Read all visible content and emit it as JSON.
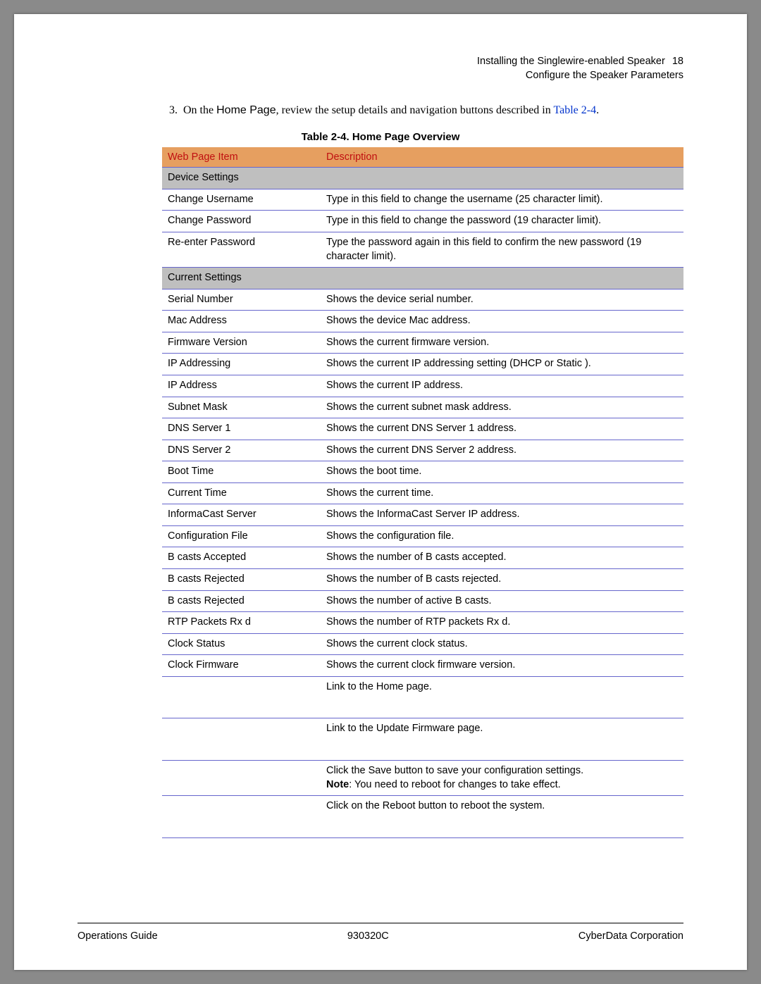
{
  "header": {
    "line1": "Installing the Singlewire-enabled Speaker",
    "page_number": "18",
    "line2": "Configure the Speaker Parameters"
  },
  "intro": {
    "number": "3.",
    "text_before_bold": "On the ",
    "bold_text": "Home Page",
    "text_after_bold": ", review the setup details and navigation buttons described in ",
    "link_text": "Table 2-4",
    "period": "."
  },
  "table_caption": "Table 2-4. Home Page Overview",
  "columns": {
    "col1": "Web Page Item",
    "col2": "Description"
  },
  "sections": [
    {
      "title": "Device Settings",
      "rows": [
        {
          "item": "Change Username",
          "desc": "Type in this field to change the username (25 character limit)."
        },
        {
          "item": "Change Password",
          "desc": "Type in this field to change the password (19 character limit)."
        },
        {
          "item": "Re-enter Password",
          "desc": "Type the password again in this field to confirm the new password (19 character limit)."
        }
      ]
    },
    {
      "title": "Current Settings",
      "rows": [
        {
          "item": "Serial Number",
          "desc": "Shows the device serial number."
        },
        {
          "item": "Mac Address",
          "desc": "Shows the device Mac address."
        },
        {
          "item": "Firmware Version",
          "desc": "Shows the current firmware version."
        },
        {
          "item": "IP Addressing",
          "desc": "Shows the current IP addressing setting (DHCP or Static )."
        },
        {
          "item": "IP Address",
          "desc": "Shows the current IP address."
        },
        {
          "item": "Subnet Mask",
          "desc": "Shows the current subnet mask address."
        },
        {
          "item": "DNS Server 1",
          "desc": "Shows the current DNS Server 1 address."
        },
        {
          "item": "DNS Server 2",
          "desc": "Shows the current DNS Server 2 address."
        },
        {
          "item": "Boot Time",
          "desc": "Shows the boot time."
        },
        {
          "item": "Current Time",
          "desc": "Shows the current time."
        },
        {
          "item": "InformaCast Server",
          "desc": "Shows the InformaCast Server IP address."
        },
        {
          "item": "Configuration File",
          "desc": "Shows the configuration file."
        },
        {
          "item": "B casts Accepted",
          "desc": "Shows the number of B casts accepted."
        },
        {
          "item": "B casts Rejected",
          "desc": "Shows the number of B casts rejected."
        },
        {
          "item": "B casts Rejected",
          "desc": "Shows the number of active B casts."
        },
        {
          "item": "RTP Packets Rx d",
          "desc": "Shows the number of RTP packets Rx d."
        },
        {
          "item": "Clock Status",
          "desc": "Shows the current clock status."
        },
        {
          "item": "Clock Firmware",
          "desc": "Shows the current clock firmware version."
        }
      ]
    }
  ],
  "extra_rows": [
    {
      "item": "",
      "desc": "Link to the Home  page.",
      "tall": true
    },
    {
      "item": "",
      "desc": "Link to the Update Firmware   page.",
      "tall": true
    },
    {
      "item": "",
      "desc_pre": "Click the Save button to save your configuration settings.",
      "note_label": "Note",
      "note_text": ": You need to reboot for changes to take effect.",
      "tall": false
    },
    {
      "item": "",
      "desc": "Click on the Reboot  button to reboot the system.",
      "tall": true
    }
  ],
  "footer": {
    "left": "Operations Guide",
    "center": "930320C",
    "right": "CyberData Corporation"
  }
}
